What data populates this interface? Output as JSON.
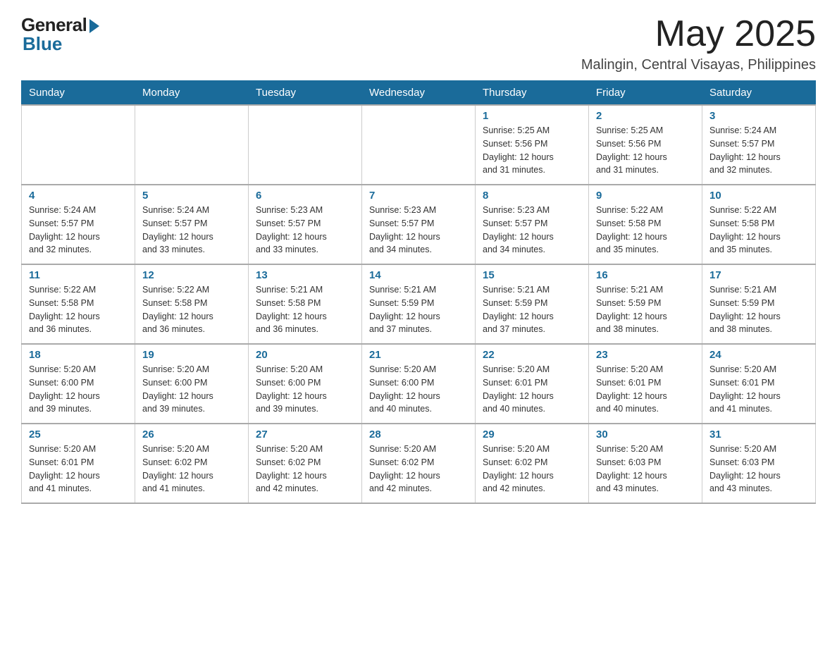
{
  "logo": {
    "general": "General",
    "blue": "Blue"
  },
  "header": {
    "month": "May 2025",
    "location": "Malingin, Central Visayas, Philippines"
  },
  "weekdays": [
    "Sunday",
    "Monday",
    "Tuesday",
    "Wednesday",
    "Thursday",
    "Friday",
    "Saturday"
  ],
  "weeks": [
    [
      {
        "day": "",
        "info": ""
      },
      {
        "day": "",
        "info": ""
      },
      {
        "day": "",
        "info": ""
      },
      {
        "day": "",
        "info": ""
      },
      {
        "day": "1",
        "info": "Sunrise: 5:25 AM\nSunset: 5:56 PM\nDaylight: 12 hours\nand 31 minutes."
      },
      {
        "day": "2",
        "info": "Sunrise: 5:25 AM\nSunset: 5:56 PM\nDaylight: 12 hours\nand 31 minutes."
      },
      {
        "day": "3",
        "info": "Sunrise: 5:24 AM\nSunset: 5:57 PM\nDaylight: 12 hours\nand 32 minutes."
      }
    ],
    [
      {
        "day": "4",
        "info": "Sunrise: 5:24 AM\nSunset: 5:57 PM\nDaylight: 12 hours\nand 32 minutes."
      },
      {
        "day": "5",
        "info": "Sunrise: 5:24 AM\nSunset: 5:57 PM\nDaylight: 12 hours\nand 33 minutes."
      },
      {
        "day": "6",
        "info": "Sunrise: 5:23 AM\nSunset: 5:57 PM\nDaylight: 12 hours\nand 33 minutes."
      },
      {
        "day": "7",
        "info": "Sunrise: 5:23 AM\nSunset: 5:57 PM\nDaylight: 12 hours\nand 34 minutes."
      },
      {
        "day": "8",
        "info": "Sunrise: 5:23 AM\nSunset: 5:57 PM\nDaylight: 12 hours\nand 34 minutes."
      },
      {
        "day": "9",
        "info": "Sunrise: 5:22 AM\nSunset: 5:58 PM\nDaylight: 12 hours\nand 35 minutes."
      },
      {
        "day": "10",
        "info": "Sunrise: 5:22 AM\nSunset: 5:58 PM\nDaylight: 12 hours\nand 35 minutes."
      }
    ],
    [
      {
        "day": "11",
        "info": "Sunrise: 5:22 AM\nSunset: 5:58 PM\nDaylight: 12 hours\nand 36 minutes."
      },
      {
        "day": "12",
        "info": "Sunrise: 5:22 AM\nSunset: 5:58 PM\nDaylight: 12 hours\nand 36 minutes."
      },
      {
        "day": "13",
        "info": "Sunrise: 5:21 AM\nSunset: 5:58 PM\nDaylight: 12 hours\nand 36 minutes."
      },
      {
        "day": "14",
        "info": "Sunrise: 5:21 AM\nSunset: 5:59 PM\nDaylight: 12 hours\nand 37 minutes."
      },
      {
        "day": "15",
        "info": "Sunrise: 5:21 AM\nSunset: 5:59 PM\nDaylight: 12 hours\nand 37 minutes."
      },
      {
        "day": "16",
        "info": "Sunrise: 5:21 AM\nSunset: 5:59 PM\nDaylight: 12 hours\nand 38 minutes."
      },
      {
        "day": "17",
        "info": "Sunrise: 5:21 AM\nSunset: 5:59 PM\nDaylight: 12 hours\nand 38 minutes."
      }
    ],
    [
      {
        "day": "18",
        "info": "Sunrise: 5:20 AM\nSunset: 6:00 PM\nDaylight: 12 hours\nand 39 minutes."
      },
      {
        "day": "19",
        "info": "Sunrise: 5:20 AM\nSunset: 6:00 PM\nDaylight: 12 hours\nand 39 minutes."
      },
      {
        "day": "20",
        "info": "Sunrise: 5:20 AM\nSunset: 6:00 PM\nDaylight: 12 hours\nand 39 minutes."
      },
      {
        "day": "21",
        "info": "Sunrise: 5:20 AM\nSunset: 6:00 PM\nDaylight: 12 hours\nand 40 minutes."
      },
      {
        "day": "22",
        "info": "Sunrise: 5:20 AM\nSunset: 6:01 PM\nDaylight: 12 hours\nand 40 minutes."
      },
      {
        "day": "23",
        "info": "Sunrise: 5:20 AM\nSunset: 6:01 PM\nDaylight: 12 hours\nand 40 minutes."
      },
      {
        "day": "24",
        "info": "Sunrise: 5:20 AM\nSunset: 6:01 PM\nDaylight: 12 hours\nand 41 minutes."
      }
    ],
    [
      {
        "day": "25",
        "info": "Sunrise: 5:20 AM\nSunset: 6:01 PM\nDaylight: 12 hours\nand 41 minutes."
      },
      {
        "day": "26",
        "info": "Sunrise: 5:20 AM\nSunset: 6:02 PM\nDaylight: 12 hours\nand 41 minutes."
      },
      {
        "day": "27",
        "info": "Sunrise: 5:20 AM\nSunset: 6:02 PM\nDaylight: 12 hours\nand 42 minutes."
      },
      {
        "day": "28",
        "info": "Sunrise: 5:20 AM\nSunset: 6:02 PM\nDaylight: 12 hours\nand 42 minutes."
      },
      {
        "day": "29",
        "info": "Sunrise: 5:20 AM\nSunset: 6:02 PM\nDaylight: 12 hours\nand 42 minutes."
      },
      {
        "day": "30",
        "info": "Sunrise: 5:20 AM\nSunset: 6:03 PM\nDaylight: 12 hours\nand 43 minutes."
      },
      {
        "day": "31",
        "info": "Sunrise: 5:20 AM\nSunset: 6:03 PM\nDaylight: 12 hours\nand 43 minutes."
      }
    ]
  ]
}
